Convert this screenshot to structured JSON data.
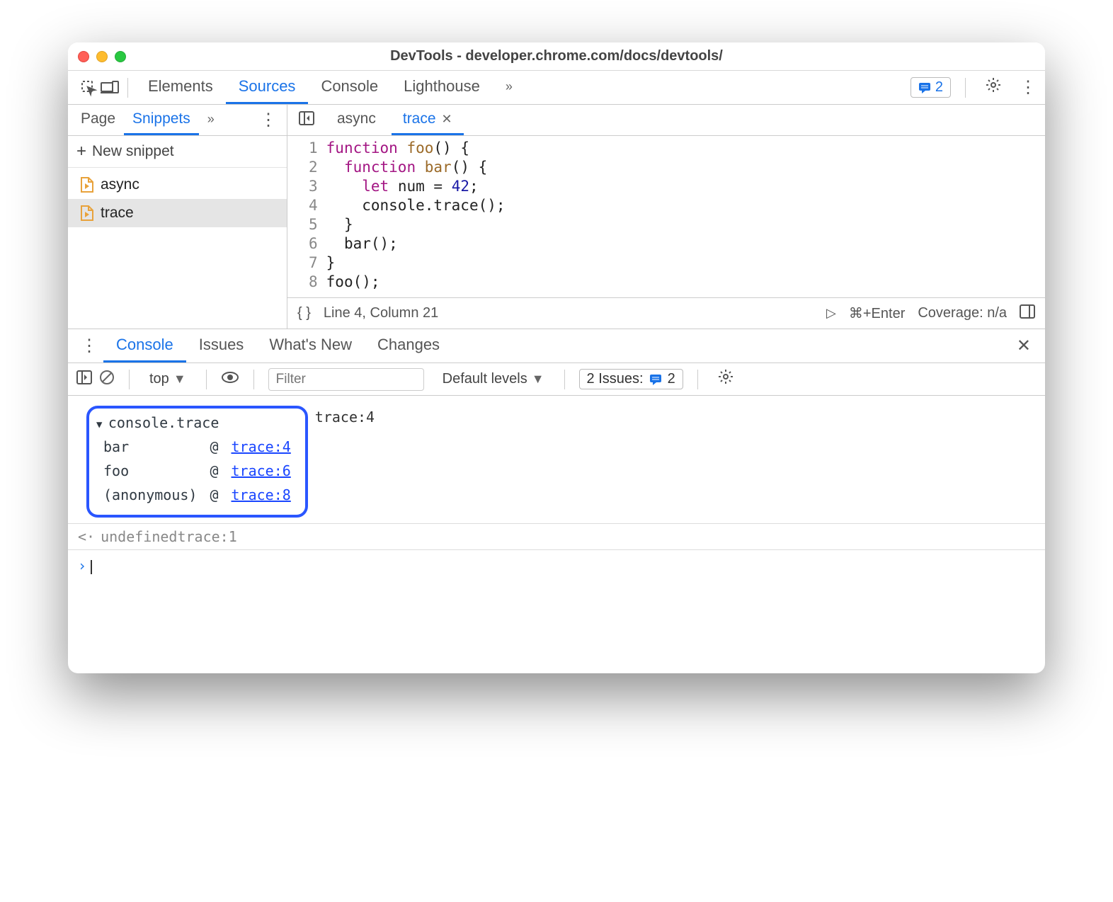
{
  "window": {
    "title": "DevTools - developer.chrome.com/docs/devtools/"
  },
  "toolbar": {
    "tabs": [
      "Elements",
      "Sources",
      "Console",
      "Lighthouse"
    ],
    "active_tab": "Sources",
    "overflow": "»",
    "issues_count": "2"
  },
  "left": {
    "tabs": [
      "Page",
      "Snippets"
    ],
    "active_tab": "Snippets",
    "overflow": "»",
    "new_snippet": "New snippet",
    "snippets": [
      "async",
      "trace"
    ],
    "selected": "trace"
  },
  "editor": {
    "tabs": [
      {
        "label": "async",
        "active": false
      },
      {
        "label": "trace",
        "active": true
      }
    ],
    "lines": [
      {
        "n": 1,
        "html": "<span class='kw'>function</span> <span class='name'>foo</span>() {"
      },
      {
        "n": 2,
        "html": "  <span class='kw'>function</span> <span class='name'>bar</span>() {"
      },
      {
        "n": 3,
        "html": "    <span class='kw'>let</span> num = <span class='num'>42</span>;"
      },
      {
        "n": 4,
        "html": "    console.trace();"
      },
      {
        "n": 5,
        "html": "  }"
      },
      {
        "n": 6,
        "html": "  bar();"
      },
      {
        "n": 7,
        "html": "}"
      },
      {
        "n": 8,
        "html": "foo();"
      }
    ],
    "status": {
      "pos": "Line 4, Column 21",
      "hint": "⌘+Enter",
      "coverage": "Coverage: n/a"
    }
  },
  "drawer": {
    "tabs": [
      "Console",
      "Issues",
      "What's New",
      "Changes"
    ],
    "active_tab": "Console"
  },
  "console_toolbar": {
    "context": "top",
    "filter_placeholder": "Filter",
    "levels": "Default levels",
    "issues_label": "2 Issues:",
    "issues_count": "2"
  },
  "console": {
    "trace_label": "console.trace",
    "trace_src": "trace:4",
    "stack": [
      {
        "fn": "bar",
        "at": "@",
        "loc": "trace:4"
      },
      {
        "fn": "foo",
        "at": "@",
        "loc": "trace:6"
      },
      {
        "fn": "(anonymous)",
        "at": "@",
        "loc": "trace:8"
      }
    ],
    "undef_label": "undefined",
    "undef_src": "trace:1"
  }
}
